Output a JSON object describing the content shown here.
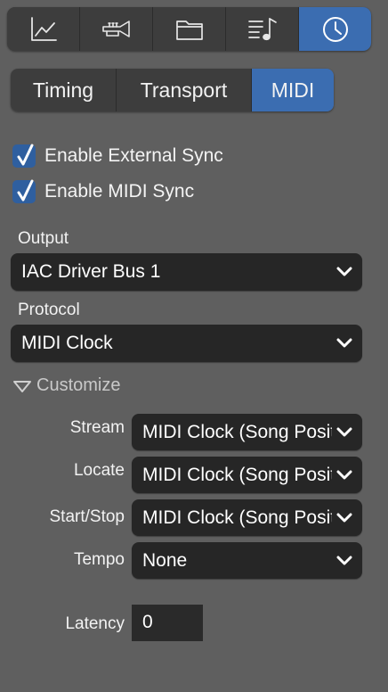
{
  "toolbar": {
    "buttons": [
      {
        "icon": "chart-line-icon",
        "active": false
      },
      {
        "icon": "trumpet-icon",
        "active": false
      },
      {
        "icon": "folder-icon",
        "active": false
      },
      {
        "icon": "score-list-icon",
        "active": false
      },
      {
        "icon": "clock-icon",
        "active": true
      }
    ],
    "accent_color": "#3b6db1"
  },
  "tabs": [
    {
      "label": "Timing",
      "active": false
    },
    {
      "label": "Transport",
      "active": false
    },
    {
      "label": "MIDI",
      "active": true
    }
  ],
  "sync": {
    "external_sync_label": "Enable External Sync",
    "external_sync_checked": true,
    "midi_sync_label": "Enable MIDI Sync",
    "midi_sync_checked": true
  },
  "output": {
    "label": "Output",
    "value": "IAC Driver Bus 1"
  },
  "protocol": {
    "label": "Protocol",
    "value": "MIDI Clock"
  },
  "customize": {
    "label": "Customize",
    "expanded": true,
    "stream_label": "Stream",
    "stream_value": "MIDI Clock (Song Position)",
    "locate_label": "Locate",
    "locate_value": "MIDI Clock (Song Position)",
    "startstop_label": "Start/Stop",
    "startstop_value": "MIDI Clock (Song Position)",
    "tempo_label": "Tempo",
    "tempo_value": "None"
  },
  "latency": {
    "label": "Latency",
    "value": "0"
  }
}
